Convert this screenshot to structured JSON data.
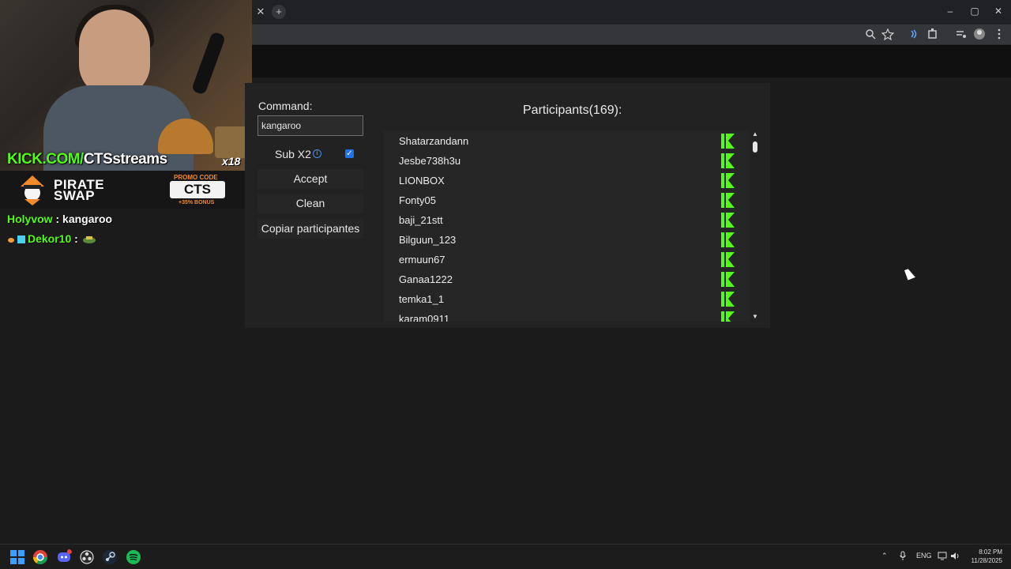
{
  "stream_overlay": {
    "kick_url_prefix": "KICK.COM/",
    "kick_url_channel": "CTSstreams",
    "age_badge": "x18",
    "sponsor": {
      "name_line1": "PIRATE",
      "name_line2": "SWAP",
      "promo_label": "PROMO CODE",
      "promo_code": "CTS",
      "promo_bonus": "+35% BONUS"
    },
    "chat": [
      {
        "user": "Holyvow",
        "sep": " : ",
        "message": "kangaroo"
      },
      {
        "user": "Dekor10",
        "sep": " : ",
        "message": ""
      }
    ]
  },
  "browser": {
    "tab_close_icon": "close-icon",
    "new_tab_icon": "plus-icon",
    "window_controls": [
      "minimize-icon",
      "restore-icon",
      "close-icon"
    ],
    "window_glyphs": [
      "–",
      "▢",
      "✕"
    ],
    "toolbar_icons": [
      "zoom-icon",
      "star-icon",
      "read-aloud-icon",
      "extensions-icon",
      "media-icon",
      "profile-icon",
      "menu-icon"
    ]
  },
  "app": {
    "command_label": "Command:",
    "command_value": "kangaroo",
    "sub_label": "Sub X2",
    "sub_checked": true,
    "buttons": {
      "accept": "Accept",
      "clean": "Clean",
      "copy": "Copiar participantes"
    },
    "participants_title": "Participants(169):",
    "participants": [
      "Shatarzandann",
      "Jesbe738h3u",
      "LIONBOX",
      "Fonty05",
      "baji_21stt",
      "Bilguun_123",
      "ermuun67",
      "Ganaa1222",
      "temka1_1",
      "karam0911"
    ]
  },
  "taskbar": {
    "apps": [
      "windows-start-icon",
      "chrome-icon",
      "discord-icon",
      "obs-icon",
      "steam-icon",
      "spotify-icon"
    ],
    "language": "ENG",
    "time": "8:02 PM",
    "date": "11/28/2025"
  },
  "colors": {
    "kick_green": "#53fc18",
    "page_bg": "#1b1b1b",
    "panel_bg": "#222222",
    "accent_blue": "#1e73e8"
  }
}
